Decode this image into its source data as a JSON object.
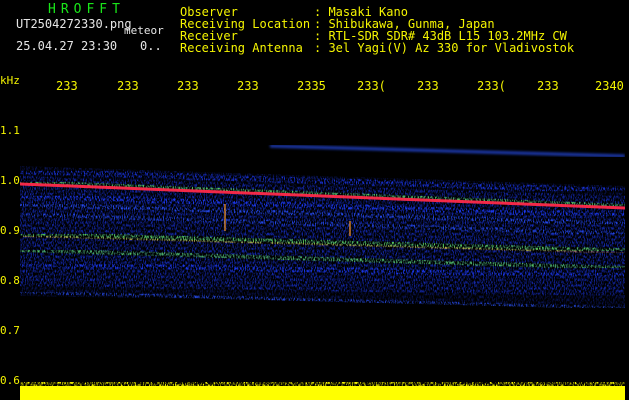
{
  "header": {
    "brand": "HROFFT",
    "file_name": "UT2504272330.png",
    "meteor_label": "meteor",
    "datetime": "25.04.27 23:30",
    "counter": "0.."
  },
  "station": [
    {
      "label": "Observer",
      "value": ": Masaki Kano"
    },
    {
      "label": "Receiving Location",
      "value": ": Shibukawa, Gunma, Japan"
    },
    {
      "label": "Receiver",
      "value": ": RTL-SDR SDR# 43dB L15 103.2MHz CW"
    },
    {
      "label": "Receiving Antenna",
      "value": ": 3el Yagi(V) Az 330 for Vladivostok"
    }
  ],
  "axes": {
    "x_ticks": [
      "233",
      "233",
      "233",
      "233",
      "2335",
      "233(",
      "233",
      "233(",
      "233",
      "2340"
    ],
    "y_unit": "kHz",
    "y_ticks": [
      "1.1",
      "1.0",
      "0.9",
      "0.8",
      "0.7",
      "0.6"
    ]
  },
  "colors": {
    "background": "#000000",
    "label_yellow": "#f5f500",
    "brand_green": "#19e619",
    "echo_red": "#ff2a4a",
    "echo_green": "#6cff3c",
    "noise_blue": "#1e3cff",
    "bar_yellow": "#ffff00"
  }
}
